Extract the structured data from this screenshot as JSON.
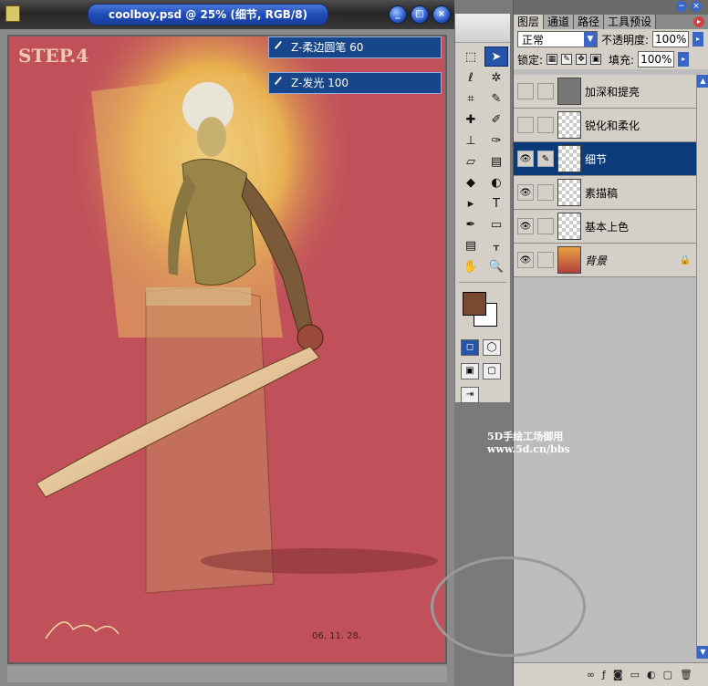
{
  "document": {
    "title": "coolboy.psd @ 25% (细节, RGB/8)",
    "window_buttons": [
      "_",
      "□",
      "×"
    ],
    "canvas_caption": "STEP.4",
    "canvas_date": "06. 11. 28."
  },
  "actions": [
    {
      "label": "Z-柔边圆笔 60"
    },
    {
      "label": "Z-发光 100"
    }
  ],
  "toolbox": {
    "foreground_color": "#7a4a30",
    "background_color": "#ffffff",
    "tools": [
      "marquee-icon",
      "move-icon",
      "lasso-icon",
      "magic-wand-icon",
      "crop-icon",
      "slice-icon",
      "healing-icon",
      "brush-icon",
      "stamp-icon",
      "history-brush-icon",
      "eraser-icon",
      "gradient-icon",
      "blur-icon",
      "dodge-icon",
      "path-select-icon",
      "type-icon",
      "pen-icon",
      "shape-icon",
      "notes-icon",
      "eyedropper-icon",
      "hand-icon",
      "zoom-icon"
    ],
    "tool_glyphs": [
      "⬚",
      "➤",
      "ℓ",
      "✲",
      "⌗",
      "✎",
      "✚",
      "✐",
      "⊥",
      "✑",
      "▱",
      "▤",
      "◆",
      "◐",
      "▸",
      "T",
      "✒",
      "▭",
      "▤",
      "ᚁ",
      "✋",
      "🔍"
    ]
  },
  "layers_panel": {
    "tabs": [
      "图层",
      "通道",
      "路径",
      "工具预设"
    ],
    "blend_mode": "正常",
    "opacity_label": "不透明度:",
    "opacity_value": "100%",
    "lock_label": "锁定:",
    "fill_label": "填充:",
    "fill_value": "100%",
    "layers": [
      {
        "name": "加深和提亮",
        "visible": false,
        "thumb": "grey"
      },
      {
        "name": "锐化和柔化",
        "visible": false,
        "thumb": "transparent"
      },
      {
        "name": "细节",
        "visible": true,
        "thumb": "transparent",
        "selected": true
      },
      {
        "name": "素描稿",
        "visible": true,
        "thumb": "transparent"
      },
      {
        "name": "基本上色",
        "visible": true,
        "thumb": "transparent"
      },
      {
        "name": "背景",
        "visible": true,
        "thumb": "bg",
        "locked": true
      }
    ]
  },
  "watermark": {
    "line1": "5D手绘工场御用",
    "line2": "www.5d.cn/bbs"
  }
}
